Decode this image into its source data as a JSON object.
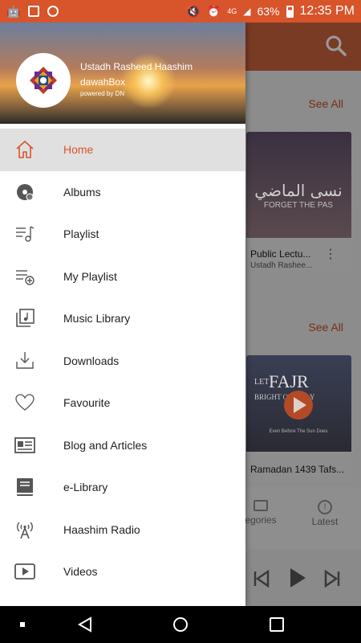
{
  "status_bar": {
    "battery": "63%",
    "time": "12:35 PM",
    "network": "4G"
  },
  "background_app": {
    "see_all_1": "See All",
    "see_all_2": "See All",
    "card1": {
      "title": "Public Lectu...",
      "subtitle": "Ustadh Rashee...",
      "thumb_text": "نسى الماضي",
      "thumb_sub": "FORGET THE PAS"
    },
    "card2": {
      "title": "Ramadan 1439 Tafs...",
      "thumb_top": "LET",
      "thumb_big": "FAJR",
      "thumb_mid": "BRIGHT   OUR DAY",
      "thumb_sub": "Even Before The Sun Does"
    },
    "bottom_nav": [
      {
        "label": "egories",
        "icon": "folder-icon"
      },
      {
        "label": "Latest",
        "icon": "alert-circle-icon"
      }
    ]
  },
  "drawer": {
    "header": {
      "name": "Ustadh Rasheed Haashim",
      "app": "dawahBox",
      "powered": "powered by DN"
    },
    "items": [
      {
        "label": "Home",
        "icon": "home-icon",
        "active": true
      },
      {
        "label": "Albums",
        "icon": "album-disc-icon"
      },
      {
        "label": "Playlist",
        "icon": "playlist-icon"
      },
      {
        "label": "My Playlist",
        "icon": "playlist-add-icon"
      },
      {
        "label": "Music Library",
        "icon": "music-library-icon"
      },
      {
        "label": "Downloads",
        "icon": "download-icon"
      },
      {
        "label": "Favourite",
        "icon": "heart-icon"
      },
      {
        "label": "Blog and Articles",
        "icon": "newspaper-icon"
      },
      {
        "label": "e-Library",
        "icon": "book-icon"
      },
      {
        "label": "Haashim Radio",
        "icon": "radio-tower-icon"
      },
      {
        "label": "Videos",
        "icon": "video-icon"
      }
    ]
  },
  "colors": {
    "accent": "#d8542a",
    "active_bg": "#e0e0e0"
  }
}
